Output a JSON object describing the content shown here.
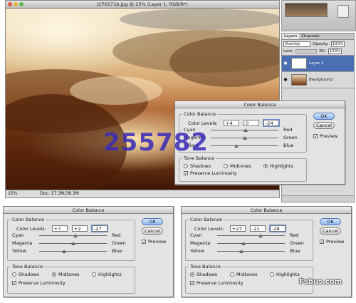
{
  "photo_window": {
    "title": "JCP0171b.jpg @ 25% (Layer 1, RGB/8*)",
    "zoom": "25%",
    "doc_info": "Doc: 17.3M/38.3M"
  },
  "layers_panel": {
    "tabs": [
      "Layers",
      "Channels"
    ],
    "blend_mode": "Overlay",
    "opacity_label": "Opacity:",
    "opacity_value": "100%",
    "lock_label": "Lock:",
    "fill_label": "Fill:",
    "fill_value": "100%",
    "layers": [
      "Layer 1",
      "Background"
    ]
  },
  "dialog_main": {
    "title": "Color Balance",
    "group_color": "Color Balance",
    "levels_label": "Color Levels:",
    "levels": [
      "+4",
      "0",
      "-24"
    ],
    "rows": [
      {
        "left": "Cyan",
        "right": "Red",
        "pos": 0.52
      },
      {
        "left": "Magenta",
        "right": "Green",
        "pos": 0.5
      },
      {
        "left": "Yellow",
        "right": "Blue",
        "pos": 0.38
      }
    ],
    "group_tone": "Tone Balance",
    "tones": [
      "Shadows",
      "Midtones",
      "Highlights"
    ],
    "tone_selected": 2,
    "preserve": "Preserve Luminosity",
    "ok": "OK",
    "cancel": "Cancel",
    "preview": "Preview"
  },
  "dialog_left": {
    "title": "Color Balance",
    "group_color": "Color Balance",
    "levels_label": "Color Levels:",
    "levels": [
      "+7",
      "+2",
      "-27"
    ],
    "rows": [
      {
        "left": "Cyan",
        "right": "Red",
        "pos": 0.54
      },
      {
        "left": "Magenta",
        "right": "Green",
        "pos": 0.51
      },
      {
        "left": "Yellow",
        "right": "Blue",
        "pos": 0.37
      }
    ],
    "group_tone": "Tone Balance",
    "tones": [
      "Shadows",
      "Midtones",
      "Highlights"
    ],
    "tone_selected": 1,
    "preserve": "Preserve Luminosity",
    "ok": "OK",
    "cancel": "Cancel",
    "preview": "Preview"
  },
  "dialog_right": {
    "title": "Color Balance",
    "group_color": "Color Balance",
    "levels_label": "Color Levels:",
    "levels": [
      "+27",
      "-21",
      "-28"
    ],
    "rows": [
      {
        "left": "Cyan",
        "right": "Red",
        "pos": 0.64
      },
      {
        "left": "Magenta",
        "right": "Green",
        "pos": 0.39
      },
      {
        "left": "Yellow",
        "right": "Blue",
        "pos": 0.36
      }
    ],
    "group_tone": "Tone Balance",
    "tones": [
      "Shadows",
      "Midtones",
      "Highlights"
    ],
    "tone_selected": 0,
    "preserve": "Preserve Luminosity",
    "ok": "OK",
    "cancel": "Cancel",
    "preview": "Preview"
  },
  "watermark": "255782",
  "logo": "Fsbus.com"
}
